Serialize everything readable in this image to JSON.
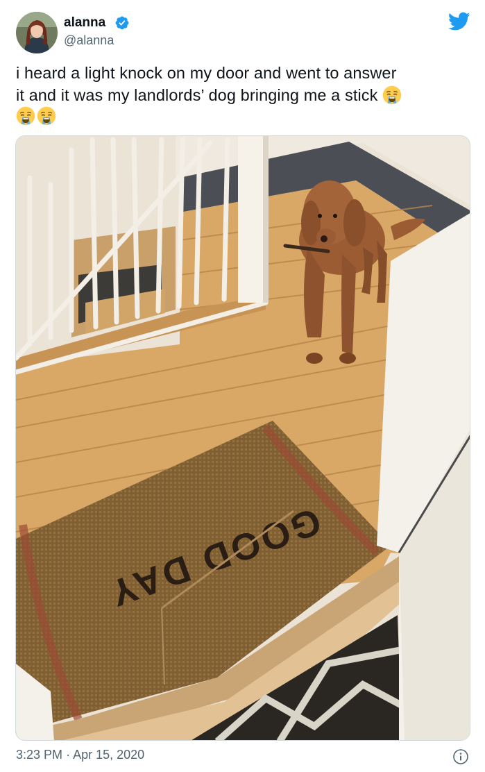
{
  "author": {
    "display_name": "alanna",
    "handle": "@alanna",
    "verified": true
  },
  "tweet": {
    "text_line_1": "i heard a light knock on my door and went to answer",
    "text_line_2": "it and it was my landlords’ dog bringing me a stick",
    "emoji": "loudly-crying-face",
    "emoji_count": 3
  },
  "media": {
    "description_hidden": "",
    "doormat_text": "GOOD DAY"
  },
  "footer": {
    "time": "3:23 PM",
    "separator": "·",
    "date": "Apr 15, 2020"
  },
  "colors": {
    "brand_blue": "#1d9bf0",
    "text_primary": "#0f1419",
    "text_secondary": "#536471"
  },
  "icons": {
    "brand": "twitter-bird-icon",
    "verified": "verified-badge-icon",
    "info": "info-icon"
  }
}
